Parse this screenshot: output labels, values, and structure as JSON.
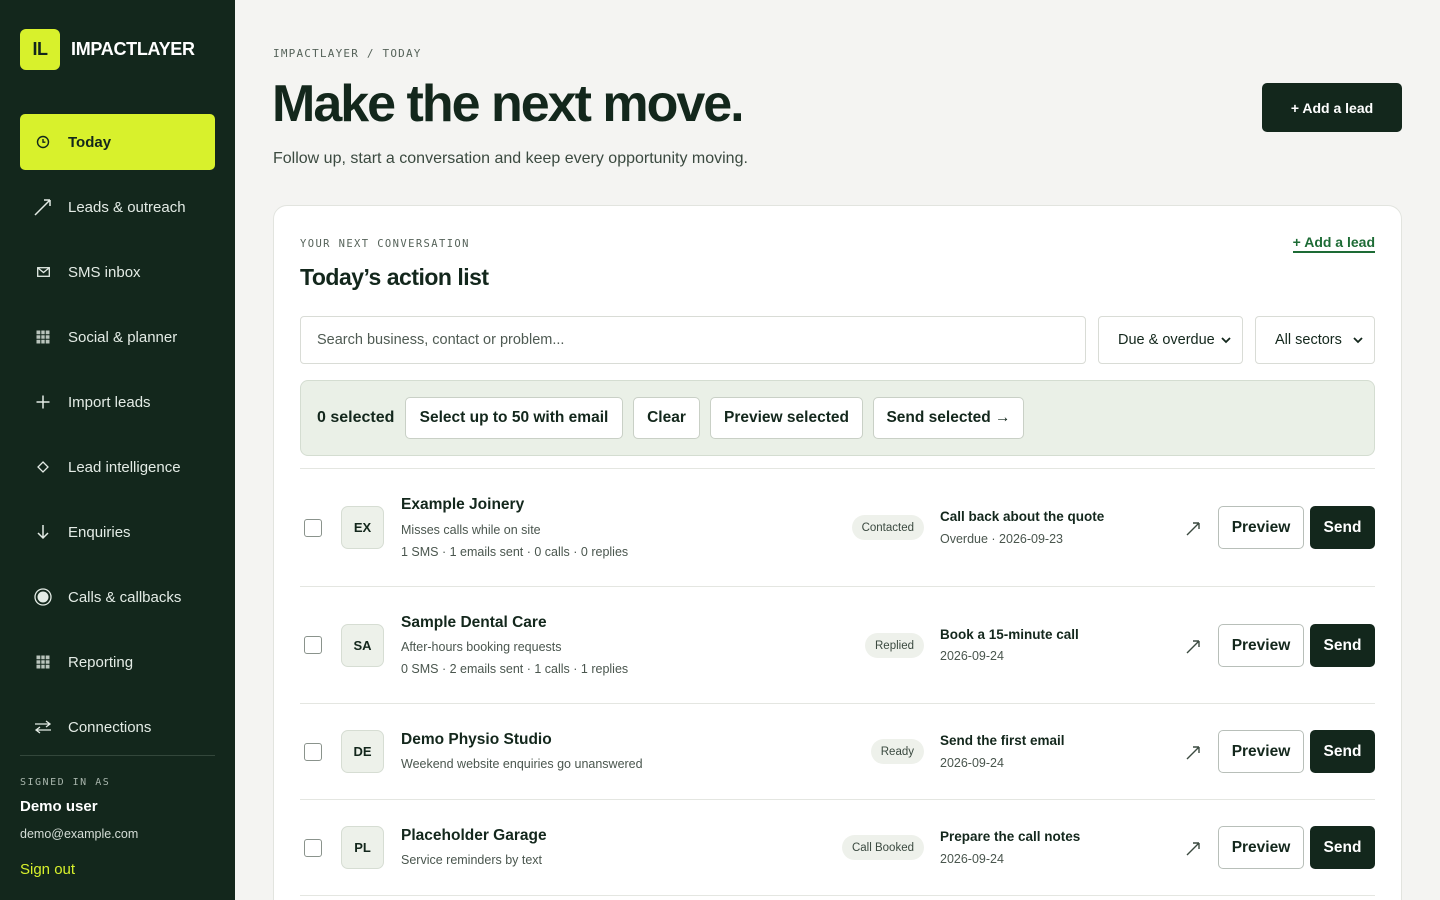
{
  "brand": {
    "logo": "IL",
    "name": "IMPACTLAYER",
    "accent": "#d8f12c",
    "dark": "#13271c"
  },
  "sidebar": {
    "items": [
      {
        "label": "Today",
        "icon": "clock-icon",
        "active": true
      },
      {
        "label": "Leads & outreach",
        "icon": "arrow-up-right-icon"
      },
      {
        "label": "SMS inbox",
        "icon": "envelope-icon"
      },
      {
        "label": "Social & planner",
        "icon": "grid-icon"
      },
      {
        "label": "Import leads",
        "icon": "plus-icon"
      },
      {
        "label": "Lead intelligence",
        "icon": "diamond-icon"
      },
      {
        "label": "Enquiries",
        "icon": "arrow-down-icon"
      },
      {
        "label": "Calls & callbacks",
        "icon": "target-icon"
      },
      {
        "label": "Reporting",
        "icon": "grid-icon"
      },
      {
        "label": "Connections",
        "icon": "swap-icon"
      }
    ],
    "signed_in_label": "SIGNED IN AS",
    "user_name": "Demo user",
    "user_email": "demo@example.com",
    "sign_out": "Sign out"
  },
  "header": {
    "breadcrumb": "IMPACTLAYER / TODAY",
    "title": "Make the next move.",
    "subtitle": "Follow up, start a conversation and keep every opportunity moving.",
    "add_lead": "+ Add a lead"
  },
  "card": {
    "eyebrow": "YOUR NEXT CONVERSATION",
    "title": "Today’s action list",
    "add_lead_link": "+ Add a lead",
    "search_placeholder": "Search business, contact or problem...",
    "filter_due": "Due & overdue",
    "filter_sector": "All sectors",
    "bulk": {
      "selected": "0 selected",
      "select_50": "Select up to 50 with email",
      "clear": "Clear",
      "preview_selected": "Preview selected",
      "send_selected": "Send selected →"
    }
  },
  "rows": [
    {
      "initials": "EX",
      "business": "Example Joinery",
      "problem": "Misses calls while on site",
      "stats": "1 SMS · 1 emails sent · 0 calls · 0 replies",
      "status": "Contacted",
      "task": "Call back about the quote",
      "due": "Overdue · 2026-09-23",
      "preview": "Preview",
      "send": "Send"
    },
    {
      "initials": "SA",
      "business": "Sample Dental Care",
      "problem": "After-hours booking requests",
      "stats": "0 SMS · 2 emails sent · 1 calls · 1 replies",
      "status": "Replied",
      "task": "Book a 15-minute call",
      "due": "2026-09-24",
      "preview": "Preview",
      "send": "Send"
    },
    {
      "initials": "DE",
      "business": "Demo Physio Studio",
      "problem": "Weekend website enquiries go unanswered",
      "stats": "",
      "status": "Ready",
      "task": "Send the first email",
      "due": "2026-09-24",
      "preview": "Preview",
      "send": "Send"
    },
    {
      "initials": "PL",
      "business": "Placeholder Garage",
      "problem": "Service reminders by text",
      "stats": "",
      "status": "Call Booked",
      "task": "Prepare the call notes",
      "due": "2026-09-24",
      "preview": "Preview",
      "send": "Send"
    }
  ]
}
